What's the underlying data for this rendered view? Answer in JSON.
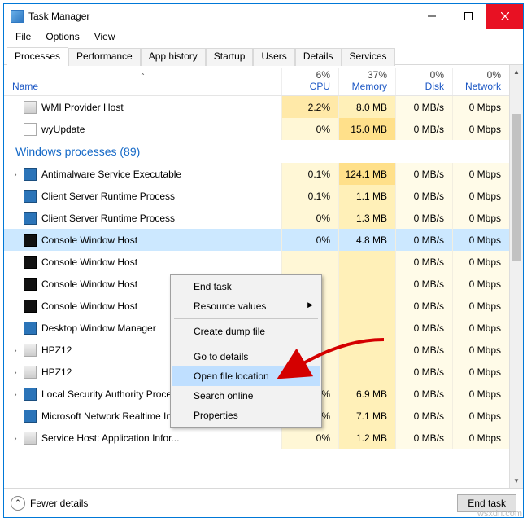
{
  "window": {
    "title": "Task Manager"
  },
  "menu": {
    "file": "File",
    "options": "Options",
    "view": "View"
  },
  "tabs": [
    "Processes",
    "Performance",
    "App history",
    "Startup",
    "Users",
    "Details",
    "Services"
  ],
  "columns": {
    "name": "Name",
    "cpu_top": "6%",
    "cpu": "CPU",
    "mem_top": "37%",
    "mem": "Memory",
    "disk_top": "0%",
    "disk": "Disk",
    "net_top": "0%",
    "net": "Network"
  },
  "group_label": "Windows processes (89)",
  "rows": [
    {
      "exp": "",
      "icon": "svc",
      "name": "WMI Provider Host",
      "cpu": "2.2%",
      "mem": "8.0 MB",
      "disk": "0 MB/s",
      "net": "0 Mbps",
      "cpu_dark": true,
      "mem_dark": false
    },
    {
      "exp": "",
      "icon": "wyu",
      "name": "wyUpdate",
      "cpu": "0%",
      "mem": "15.0 MB",
      "disk": "0 MB/s",
      "net": "0 Mbps",
      "mem_dark": true
    },
    {
      "exp": "›",
      "icon": "app",
      "name": "Antimalware Service Executable",
      "cpu": "0.1%",
      "mem": "124.1 MB",
      "disk": "0 MB/s",
      "net": "0 Mbps",
      "mem_dark": true
    },
    {
      "exp": "",
      "icon": "app",
      "name": "Client Server Runtime Process",
      "cpu": "0.1%",
      "mem": "1.1 MB",
      "disk": "0 MB/s",
      "net": "0 Mbps"
    },
    {
      "exp": "",
      "icon": "app",
      "name": "Client Server Runtime Process",
      "cpu": "0%",
      "mem": "1.3 MB",
      "disk": "0 MB/s",
      "net": "0 Mbps"
    },
    {
      "exp": "",
      "icon": "cw",
      "name": "Console Window Host",
      "cpu": "0%",
      "mem": "4.8 MB",
      "disk": "0 MB/s",
      "net": "0 Mbps",
      "sel": true
    },
    {
      "exp": "",
      "icon": "cw",
      "name": "Console Window Host",
      "cpu": "",
      "mem": "",
      "disk": "0 MB/s",
      "net": "0 Mbps"
    },
    {
      "exp": "",
      "icon": "cw",
      "name": "Console Window Host",
      "cpu": "",
      "mem": "",
      "disk": "0 MB/s",
      "net": "0 Mbps"
    },
    {
      "exp": "",
      "icon": "cw",
      "name": "Console Window Host",
      "cpu": "",
      "mem": "",
      "disk": "0 MB/s",
      "net": "0 Mbps"
    },
    {
      "exp": "",
      "icon": "app",
      "name": "Desktop Window Manager",
      "cpu": "",
      "mem": "",
      "disk": "0 MB/s",
      "net": "0 Mbps"
    },
    {
      "exp": "›",
      "icon": "svc",
      "name": "HPZ12",
      "cpu": "",
      "mem": "",
      "disk": "0 MB/s",
      "net": "0 Mbps"
    },
    {
      "exp": "›",
      "icon": "svc",
      "name": "HPZ12",
      "cpu": "",
      "mem": "",
      "disk": "0 MB/s",
      "net": "0 Mbps"
    },
    {
      "exp": "›",
      "icon": "app",
      "name": "Local Security Authority Proces...",
      "cpu": "0%",
      "mem": "6.9 MB",
      "disk": "0 MB/s",
      "net": "0 Mbps"
    },
    {
      "exp": "",
      "icon": "app",
      "name": "Microsoft Network Realtime Ins...",
      "cpu": "0%",
      "mem": "7.1 MB",
      "disk": "0 MB/s",
      "net": "0 Mbps"
    },
    {
      "exp": "›",
      "icon": "svc",
      "name": "Service Host: Application Infor...",
      "cpu": "0%",
      "mem": "1.2 MB",
      "disk": "0 MB/s",
      "net": "0 Mbps"
    }
  ],
  "context_menu": {
    "end_task": "End task",
    "resource_values": "Resource values",
    "create_dump": "Create dump file",
    "go_details": "Go to details",
    "open_file": "Open file location",
    "search_online": "Search online",
    "properties": "Properties"
  },
  "footer": {
    "fewer": "Fewer details",
    "end_task": "End task"
  },
  "watermark": "wsxdn.com"
}
